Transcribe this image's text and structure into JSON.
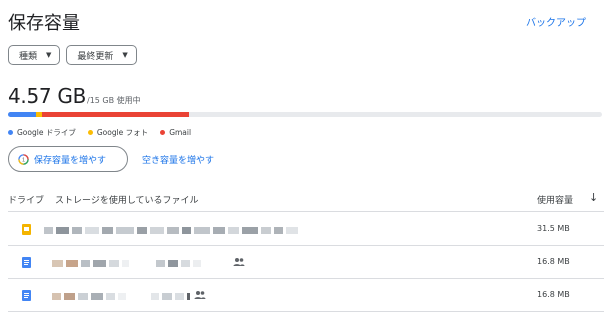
{
  "header": {
    "title": "保存容量",
    "backup_link": "バックアップ"
  },
  "filters": [
    {
      "label": "種類"
    },
    {
      "label": "最終更新"
    }
  ],
  "usage": {
    "used": "4.57 GB",
    "total_label": "/15 GB 使用中"
  },
  "storage_bar": {
    "total_gb": 15,
    "segments": [
      {
        "name": "Google ドライブ",
        "color": "#4285f4",
        "fraction": 0.047
      },
      {
        "name": "Google フォト",
        "color": "#fbbc04",
        "fraction": 0.01
      },
      {
        "name": "Gmail",
        "color": "#ea4335",
        "fraction": 0.247
      }
    ]
  },
  "legend": [
    {
      "label": "Google ドライブ",
      "color": "#4285f4"
    },
    {
      "label": "Google フォト",
      "color": "#fbbc04"
    },
    {
      "label": "Gmail",
      "color": "#ea4335"
    }
  ],
  "actions": {
    "upgrade_button": "保存容量を増やす",
    "free_up_link": "空き容量を増やす"
  },
  "list": {
    "header_drive": "ドライブ",
    "header_files": "ストレージを使用しているファイル",
    "header_size": "使用容量",
    "rows": [
      {
        "type": "slides",
        "icon_color": "#f4b400",
        "size": "31.5 MB",
        "shared": false
      },
      {
        "type": "docs",
        "icon_color": "#4285f4",
        "size": "16.8 MB",
        "shared": true
      },
      {
        "type": "docs",
        "icon_color": "#4285f4",
        "size": "16.8 MB",
        "shared": true
      }
    ]
  }
}
